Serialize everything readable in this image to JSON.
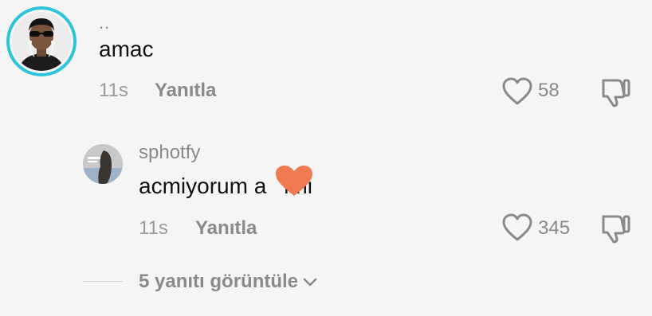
{
  "comment": {
    "username": "..",
    "text": "amac",
    "time": "11s",
    "reply_label": "Yanıtla",
    "likes": "58"
  },
  "reply": {
    "username": "sphotfy",
    "text": "acmiyorum a",
    "text_end": "imi",
    "time": "11s",
    "reply_label": "Yanıtla",
    "likes": "345"
  },
  "view_replies": {
    "label": "5 yanıtı görüntüle"
  },
  "colors": {
    "ring": "#2ec4d6",
    "heart_sticker": "#f07a52"
  },
  "icons": {
    "like": "heart-outline-icon",
    "dislike": "thumbs-down-icon",
    "expand": "chevron-down-icon"
  }
}
